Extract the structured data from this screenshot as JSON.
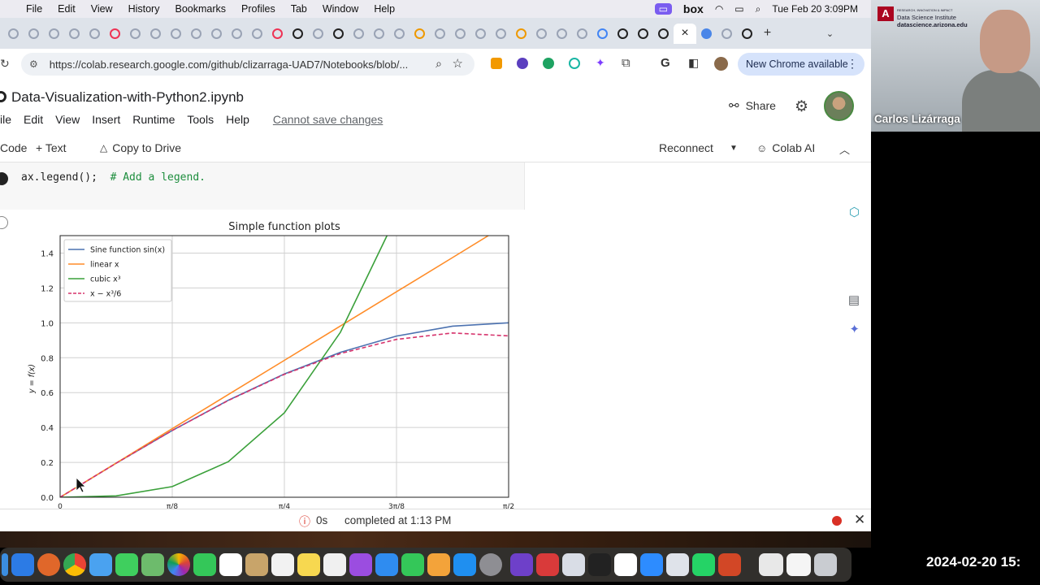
{
  "menubar": {
    "items": [
      "File",
      "Edit",
      "View",
      "History",
      "Bookmarks",
      "Profiles",
      "Tab",
      "Window",
      "Help"
    ],
    "clock": "Tue Feb 20  3:09PM",
    "box_label": "box"
  },
  "browser": {
    "url": "https://colab.research.google.com/github/clizarraga-UAD7/Notebooks/blob/...",
    "new_chrome": "New Chrome available",
    "close_tab": "×",
    "new_tab": "+"
  },
  "colab": {
    "title": "Data-Visualization-with-Python2.ipynb",
    "menu": [
      "ile",
      "Edit",
      "View",
      "Insert",
      "Runtime",
      "Tools",
      "Help"
    ],
    "cannot_save": "Cannot save changes",
    "share": "Share",
    "toolbar": {
      "code": "Code",
      "text": "+ Text",
      "copy": "Copy to Drive",
      "reconnect": "Reconnect",
      "colab_ai": "Colab AI"
    },
    "code_line": "ax.legend();",
    "code_comment": "# Add a legend."
  },
  "chart_data": {
    "type": "line",
    "title": "Simple function plots",
    "ylabel": "y = f(x)",
    "xlim": [
      0,
      1.5708
    ],
    "ylim": [
      0,
      1.5
    ],
    "yticks": [
      "0.0",
      "0.2",
      "0.4",
      "0.6",
      "0.8",
      "1.0",
      "1.2",
      "1.4"
    ],
    "xticks": [
      "0",
      "π/8",
      "π/4",
      "3π/8",
      "π/2"
    ],
    "grid": true,
    "legend_position": "top-left",
    "series": [
      {
        "name": "Sine function sin(x)",
        "color": "#4c72b0",
        "dash": false,
        "x": [
          0,
          0.1963,
          0.3927,
          0.589,
          0.7854,
          0.9817,
          1.1781,
          1.3744,
          1.5708
        ],
        "y": [
          0,
          0.195,
          0.383,
          0.556,
          0.707,
          0.831,
          0.924,
          0.981,
          1.0
        ]
      },
      {
        "name": "linear x",
        "color": "#ff8c28",
        "dash": false,
        "x": [
          0,
          0.1963,
          0.3927,
          0.589,
          0.7854,
          0.9817,
          1.1781,
          1.3744,
          1.5
        ],
        "y": [
          0,
          0.196,
          0.393,
          0.589,
          0.785,
          0.982,
          1.178,
          1.374,
          1.5
        ]
      },
      {
        "name": "cubic x³",
        "color": "#3aa03a",
        "dash": false,
        "x": [
          0,
          0.1963,
          0.3927,
          0.589,
          0.7854,
          0.9817,
          1.1447
        ],
        "y": [
          0,
          0.008,
          0.061,
          0.204,
          0.484,
          0.946,
          1.5
        ]
      },
      {
        "name": "x − x³/6",
        "color": "#d6336c",
        "dash": true,
        "x": [
          0,
          0.1963,
          0.3927,
          0.589,
          0.7854,
          0.9817,
          1.1781,
          1.3744,
          1.5708
        ],
        "y": [
          0,
          0.195,
          0.383,
          0.555,
          0.705,
          0.824,
          0.905,
          0.942,
          0.925
        ]
      }
    ]
  },
  "status": {
    "time": "0s",
    "completed": "completed at 1:13 PM"
  },
  "video": {
    "name": "Carlos Lizárraga",
    "dsi_line1": "Data Science Institute",
    "dsi_line2": "datascience.arizona.edu",
    "dsi_small": "RESEARCH, INNOVATION & IMPACT"
  },
  "timestamp": "2024-02-20  15:"
}
